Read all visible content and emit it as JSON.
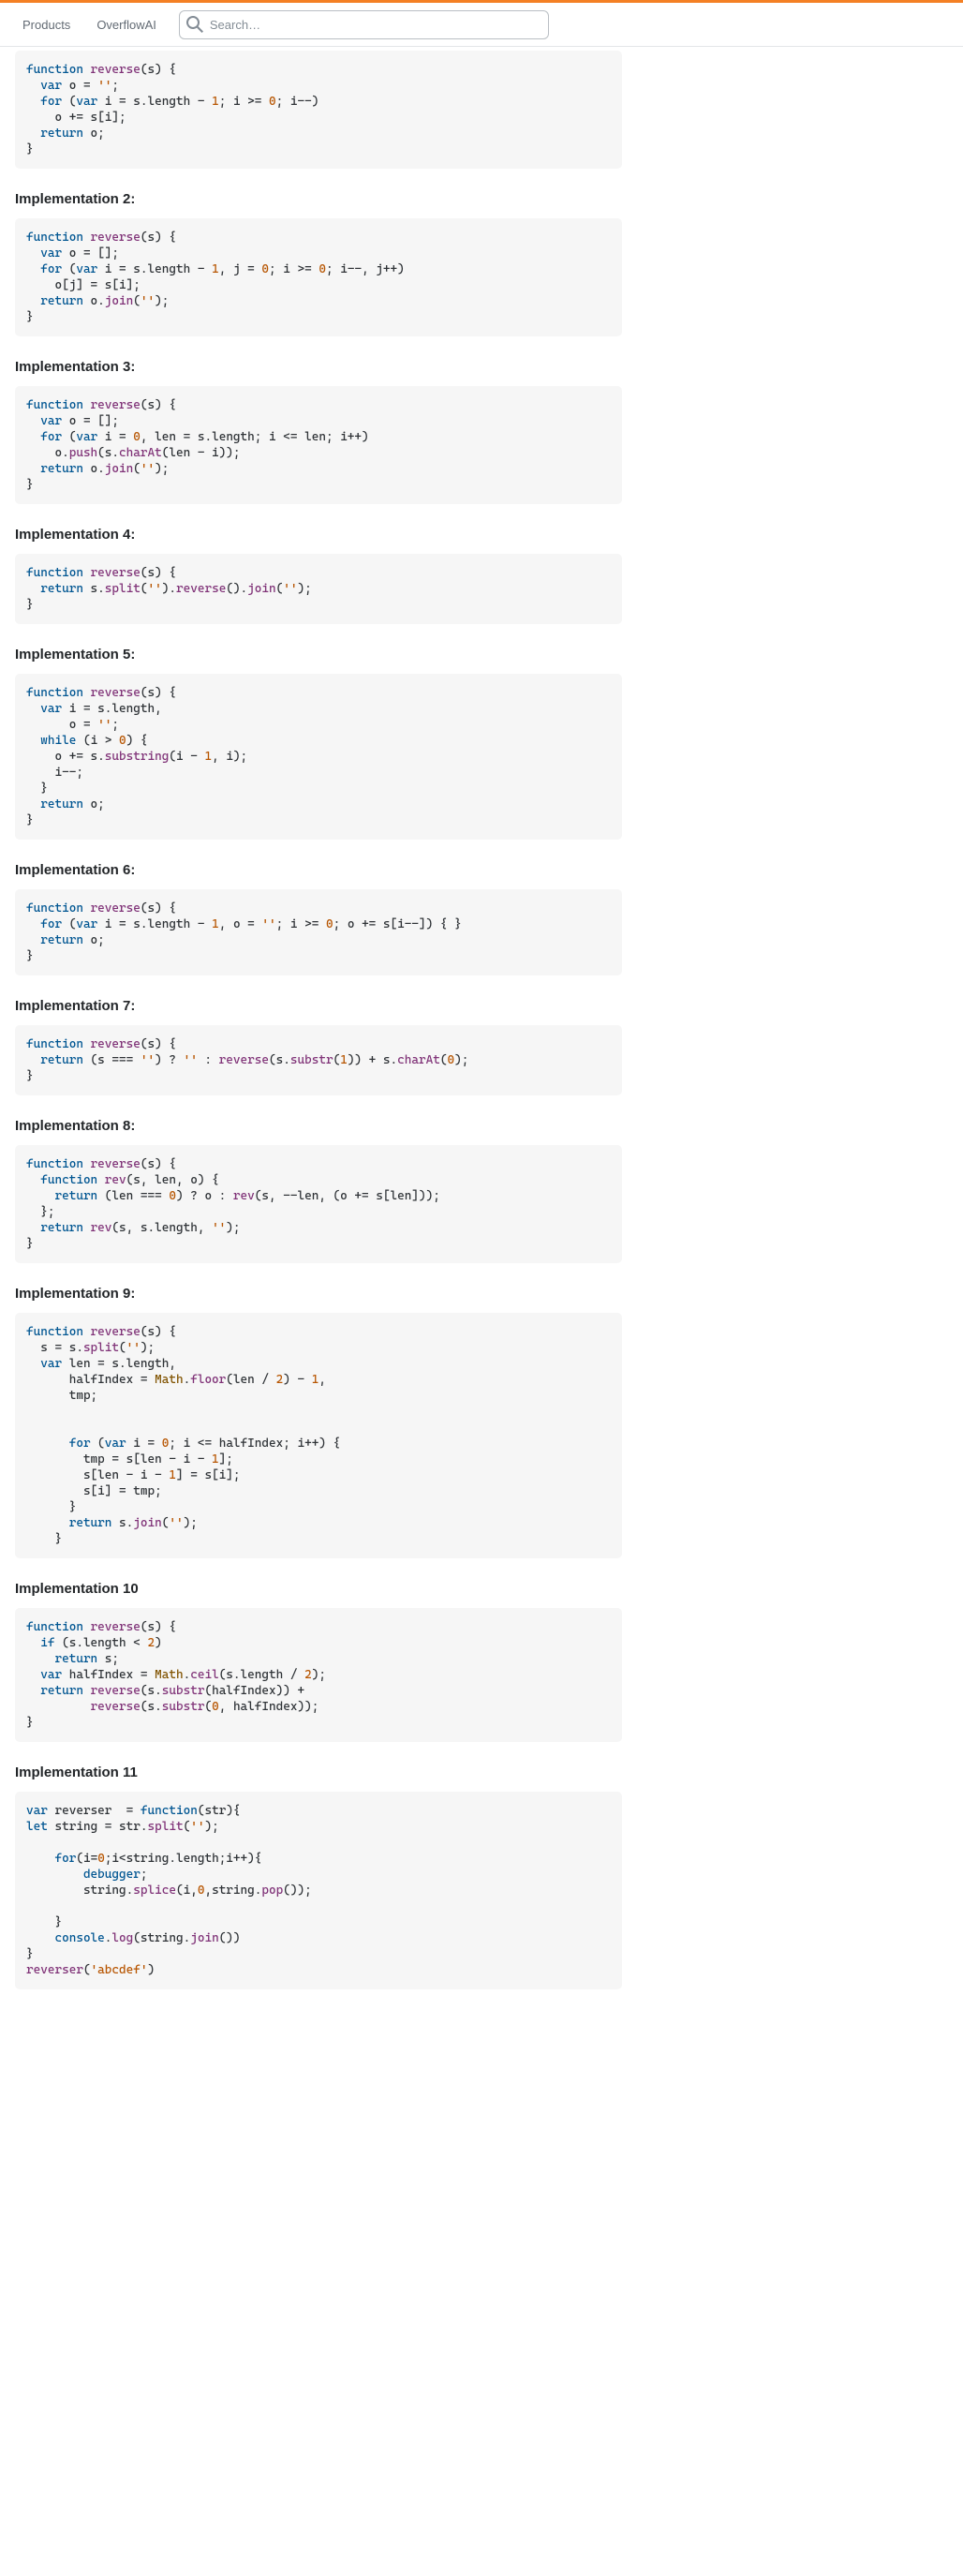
{
  "topbar": {
    "products": "Products",
    "overflowai": "OverflowAI",
    "search_placeholder": "Search…"
  },
  "sections": [
    {
      "heading": "",
      "code_html": "<span class=\"kw\">function</span> <span class=\"call\">reverse</span>(<span class=\"id\">s</span>) {\n  <span class=\"kw\">var</span> o = <span class=\"str\">''</span>;\n  <span class=\"kw\">for</span> (<span class=\"kw\">var</span> i = s.<span class=\"id\">length</span> - <span class=\"num\">1</span>; i &gt;= <span class=\"num\">0</span>; i--)\n    o += s[i];\n  <span class=\"kw\">return</span> o;\n}"
    },
    {
      "heading": "Implementation 2:",
      "code_html": "<span class=\"kw\">function</span> <span class=\"call\">reverse</span>(<span class=\"id\">s</span>) {\n  <span class=\"kw\">var</span> o = [];\n  <span class=\"kw\">for</span> (<span class=\"kw\">var</span> i = s.<span class=\"id\">length</span> - <span class=\"num\">1</span>, j = <span class=\"num\">0</span>; i &gt;= <span class=\"num\">0</span>; i--, j++)\n    o[j] = s[i];\n  <span class=\"kw\">return</span> o.<span class=\"call\">join</span>(<span class=\"str\">''</span>);\n}"
    },
    {
      "heading": "Implementation 3:",
      "code_html": "<span class=\"kw\">function</span> <span class=\"call\">reverse</span>(<span class=\"id\">s</span>) {\n  <span class=\"kw\">var</span> o = [];\n  <span class=\"kw\">for</span> (<span class=\"kw\">var</span> i = <span class=\"num\">0</span>, len = s.<span class=\"id\">length</span>; i &lt;= len; i++)\n    o.<span class=\"call\">push</span>(s.<span class=\"call\">charAt</span>(len - i));\n  <span class=\"kw\">return</span> o.<span class=\"call\">join</span>(<span class=\"str\">''</span>);\n}"
    },
    {
      "heading": "Implementation 4:",
      "code_html": "<span class=\"kw\">function</span> <span class=\"call\">reverse</span>(<span class=\"id\">s</span>) {\n  <span class=\"kw\">return</span> s.<span class=\"call\">split</span>(<span class=\"str\">''</span>).<span class=\"call\">reverse</span>().<span class=\"call\">join</span>(<span class=\"str\">''</span>);\n}"
    },
    {
      "heading": "Implementation 5:",
      "code_html": "<span class=\"kw\">function</span> <span class=\"call\">reverse</span>(<span class=\"id\">s</span>) {\n  <span class=\"kw\">var</span> i = s.<span class=\"id\">length</span>,\n      o = <span class=\"str\">''</span>;\n  <span class=\"kw\">while</span> (i &gt; <span class=\"num\">0</span>) {\n    o += s.<span class=\"call\">substring</span>(i - <span class=\"num\">1</span>, i);\n    i--;\n  }\n  <span class=\"kw\">return</span> o;\n}"
    },
    {
      "heading": "Implementation 6:",
      "code_html": "<span class=\"kw\">function</span> <span class=\"call\">reverse</span>(<span class=\"id\">s</span>) {\n  <span class=\"kw\">for</span> (<span class=\"kw\">var</span> i = s.<span class=\"id\">length</span> - <span class=\"num\">1</span>, o = <span class=\"str\">''</span>; i &gt;= <span class=\"num\">0</span>; o += s[i--]) { }\n  <span class=\"kw\">return</span> o;\n}"
    },
    {
      "heading": "Implementation 7:",
      "code_html": "<span class=\"kw\">function</span> <span class=\"call\">reverse</span>(<span class=\"id\">s</span>) {\n  <span class=\"kw\">return</span> (s === <span class=\"str\">''</span>) ? <span class=\"str\">''</span> : <span class=\"call\">reverse</span>(s.<span class=\"call\">substr</span>(<span class=\"num\">1</span>)) + s.<span class=\"call\">charAt</span>(<span class=\"num\">0</span>);\n}"
    },
    {
      "heading": "Implementation 8:",
      "code_html": "<span class=\"kw\">function</span> <span class=\"call\">reverse</span>(<span class=\"id\">s</span>) {\n  <span class=\"kw\">function</span> <span class=\"call\">rev</span>(<span class=\"id\">s, len, o</span>) {\n    <span class=\"kw\">return</span> (len === <span class=\"num\">0</span>) ? o : <span class=\"call\">rev</span>(s, --len, (o += s[len]));\n  };\n  <span class=\"kw\">return</span> <span class=\"call\">rev</span>(s, s.<span class=\"id\">length</span>, <span class=\"str\">''</span>);\n}"
    },
    {
      "heading": "Implementation 9:",
      "code_html": "<span class=\"kw\">function</span> <span class=\"call\">reverse</span>(<span class=\"id\">s</span>) {\n  s = s.<span class=\"call\">split</span>(<span class=\"str\">''</span>);\n  <span class=\"kw\">var</span> len = s.<span class=\"id\">length</span>,\n      halfIndex = <span class=\"cls\">Math</span>.<span class=\"call\">floor</span>(len / <span class=\"num\">2</span>) - <span class=\"num\">1</span>,\n      tmp;\n\n\n      <span class=\"kw\">for</span> (<span class=\"kw\">var</span> i = <span class=\"num\">0</span>; i &lt;= halfIndex; i++) {\n        tmp = s[len - i - <span class=\"num\">1</span>];\n        s[len - i - <span class=\"num\">1</span>] = s[i];\n        s[i] = tmp;\n      }\n      <span class=\"kw\">return</span> s.<span class=\"call\">join</span>(<span class=\"str\">''</span>);\n    }"
    },
    {
      "heading": "Implementation 10",
      "code_html": "<span class=\"kw\">function</span> <span class=\"call\">reverse</span>(<span class=\"id\">s</span>) {\n  <span class=\"kw\">if</span> (s.<span class=\"id\">length</span> &lt; <span class=\"num\">2</span>)\n    <span class=\"kw\">return</span> s;\n  <span class=\"kw\">var</span> halfIndex = <span class=\"cls\">Math</span>.<span class=\"call\">ceil</span>(s.<span class=\"id\">length</span> / <span class=\"num\">2</span>);\n  <span class=\"kw\">return</span> <span class=\"call\">reverse</span>(s.<span class=\"call\">substr</span>(halfIndex)) +\n         <span class=\"call\">reverse</span>(s.<span class=\"call\">substr</span>(<span class=\"num\">0</span>, halfIndex));\n}"
    },
    {
      "heading": "Implementation 11",
      "code_html": "<span class=\"kw\">var</span> reverser  = <span class=\"kw\">function</span>(<span class=\"id\">str</span>){\n<span class=\"kw\">let</span> string = str.<span class=\"call\">split</span>(<span class=\"str\">''</span>);\n\n    <span class=\"kw\">for</span>(i=<span class=\"num\">0</span>;i&lt;string.<span class=\"id\">length</span>;i++){\n        <span class=\"kw\">debugger</span>;\n        string.<span class=\"call\">splice</span>(i,<span class=\"num\">0</span>,string.<span class=\"call\">pop</span>());\n    \n    }\n    <span class=\"kw\">console</span>.<span class=\"call\">log</span>(string.<span class=\"call\">join</span>())\n}\n<span class=\"call\">reverser</span>(<span class=\"str\">'abcdef'</span>)"
    }
  ]
}
